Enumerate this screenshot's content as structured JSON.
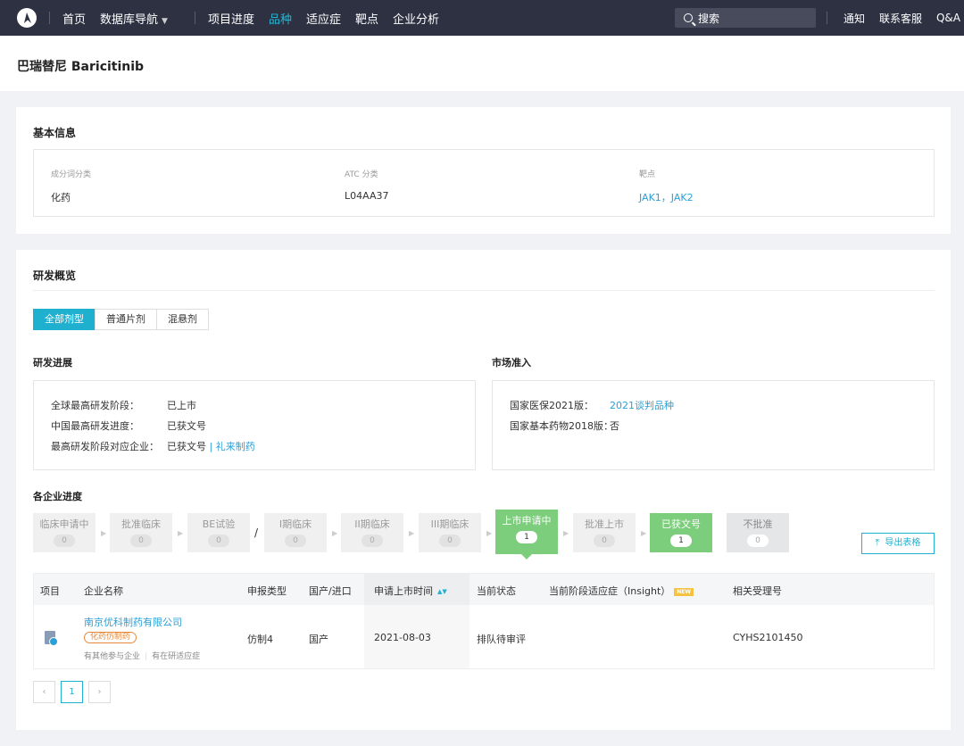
{
  "nav": {
    "items": [
      {
        "label": "首页"
      },
      {
        "label": "数据库导航"
      },
      {
        "label": "项目进度"
      },
      {
        "label": "品种"
      },
      {
        "label": "适应症"
      },
      {
        "label": "靶点"
      },
      {
        "label": "企业分析"
      }
    ],
    "active_index": 3,
    "search_placeholder": "搜索",
    "right": [
      "通知",
      "联系客服",
      "Q&A"
    ]
  },
  "page": {
    "title": "巴瑞替尼 Baricitinib"
  },
  "basic_info": {
    "title": "基本信息",
    "fields": [
      {
        "label": "成分词分类",
        "value": "化药"
      },
      {
        "label": "ATC 分类",
        "value": "L04AA37"
      },
      {
        "label": "靶点",
        "value": "JAK1，JAK2"
      }
    ]
  },
  "overview": {
    "title": "研发概览",
    "tabs": [
      "全部剂型",
      "普通片剂",
      "混悬剂"
    ],
    "active_tab": 0,
    "dev_progress": {
      "title": "研发进展",
      "rows": [
        {
          "label": "全球最高研发阶段：",
          "value": "已上市"
        },
        {
          "label": "中国最高研发进度：",
          "value": "已获文号"
        },
        {
          "label": "最高研发阶段对应企业：",
          "value": "已获文号",
          "link": "礼来制药"
        }
      ]
    },
    "market": {
      "title": "市场准入",
      "rows": [
        {
          "label": "国家医保2021版：",
          "value": "2021谈判品种"
        },
        {
          "label": "国家基本药物2018版：",
          "value": "否"
        }
      ]
    },
    "stages_title": "各企业进度",
    "stages": [
      {
        "name": "临床申请中",
        "count": "0",
        "state": "default"
      },
      {
        "name": "批准临床",
        "count": "0",
        "state": "default"
      },
      {
        "name": "BE试验",
        "count": "0",
        "state": "default"
      },
      {
        "name": "I期临床",
        "count": "0",
        "state": "default"
      },
      {
        "name": "II期临床",
        "count": "0",
        "state": "default"
      },
      {
        "name": "III期临床",
        "count": "0",
        "state": "default"
      },
      {
        "name": "上市申请中",
        "count": "1",
        "state": "selected"
      },
      {
        "name": "批准上市",
        "count": "0",
        "state": "default"
      },
      {
        "name": "已获文号",
        "count": "1",
        "state": "green"
      },
      {
        "name": "不批准",
        "count": "0",
        "state": "gray"
      }
    ],
    "slash": "/",
    "export_label": "导出表格",
    "table": {
      "headers": [
        "项目",
        "企业名称",
        "申报类型",
        "国产/进口",
        "申请上市时间",
        "当前状态",
        "当前阶段适应症（Insight）",
        "相关受理号"
      ],
      "new_badge": "NEW",
      "rows": [
        {
          "company": "南京优科制药有限公司",
          "tag": "化药仿制药",
          "sub_links": [
            "有其他参与企业",
            "有在研适应症"
          ],
          "type": "仿制4",
          "origin": "国产",
          "date": "2021-08-03",
          "status": "排队待审评",
          "indication": "",
          "acceptance_no": "CYHS2101450"
        }
      ]
    },
    "pagination": {
      "prev": "‹",
      "current": "1",
      "next": "›"
    }
  },
  "colors": {
    "nav_bg": "#2d3142",
    "accent": "#1fb0d0",
    "link": "#2a9fd8",
    "stage_green": "#7ccd7c"
  }
}
